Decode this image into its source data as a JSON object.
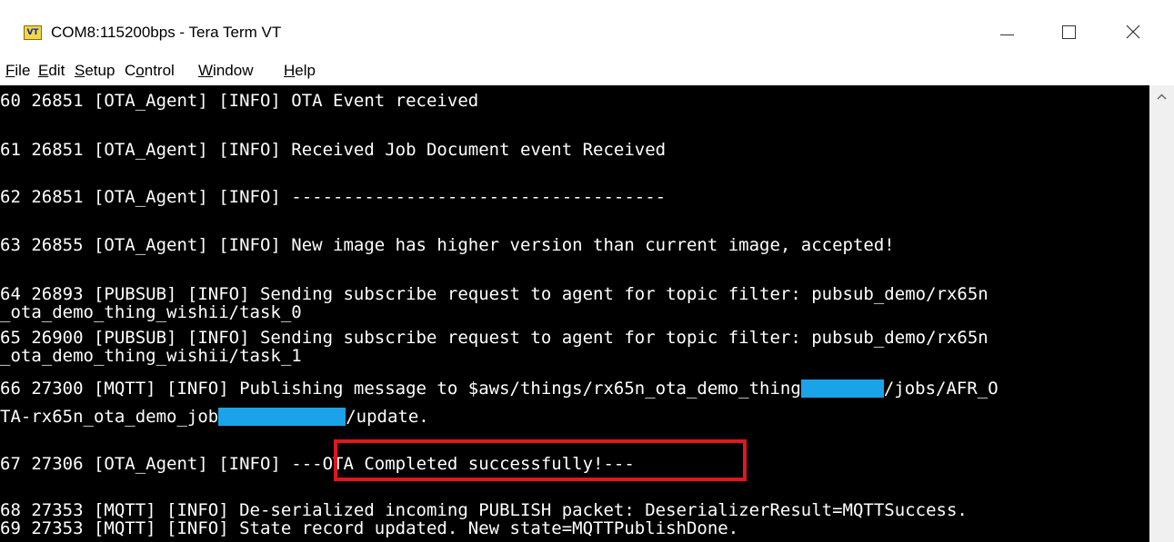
{
  "window": {
    "icon_text": "VT",
    "title": "COM8:115200bps - Tera Term VT"
  },
  "menu": {
    "items": [
      {
        "u": "F",
        "rest": "ile"
      },
      {
        "u": "E",
        "rest": "dit"
      },
      {
        "u": "S",
        "rest": "etup"
      },
      {
        "pre": "C",
        "u": "o",
        "rest": "ntrol"
      },
      {
        "u": "W",
        "rest": "indow"
      },
      {
        "u": "H",
        "rest": "elp"
      }
    ]
  },
  "terminal": {
    "lines": {
      "l60": "60 26851 [OTA_Agent] [INFO] OTA Event received",
      "l61": "61 26851 [OTA_Agent] [INFO] Received Job Document event Received",
      "l62": "62 26851 [OTA_Agent] [INFO] ------------------------------------",
      "l63": "63 26855 [OTA_Agent] [INFO] New image has higher version than current image, accepted!",
      "l64a": "64 26893 [PUBSUB] [INFO] Sending subscribe request to agent for topic filter: pubsub_demo/rx65n",
      "l64b": "_ota_demo_thing_wishii/task_0",
      "l65a": "65 26900 [PUBSUB] [INFO] Sending subscribe request to agent for topic filter: pubsub_demo/rx65n",
      "l65b": "_ota_demo_thing_wishii/task_1",
      "l66a_pre": "66 27300 [MQTT] [INFO] Publishing message to $aws/things/rx65n_ota_demo_thing",
      "l66a_post": "/jobs/AFR_O",
      "l66b_pre": "TA-rx65n_ota_demo_job",
      "l66b_post": "/update.",
      "l67_pre": "67 27306 [OTA_Agent] [INFO] ",
      "l67_highlight": "---OTA Completed successfully!---",
      "l68": "68 27353 [MQTT] [INFO] De-serialized incoming PUBLISH packet: DeserializerResult=MQTTSuccess.",
      "l69": "69 27353 [MQTT] [INFO] State record updated. New state=MQTTPublishDone."
    }
  },
  "colors": {
    "terminal_bg": "#000000",
    "terminal_fg": "#ffffff",
    "redaction": "#1aa3e8",
    "highlight_border": "#e0171b"
  }
}
